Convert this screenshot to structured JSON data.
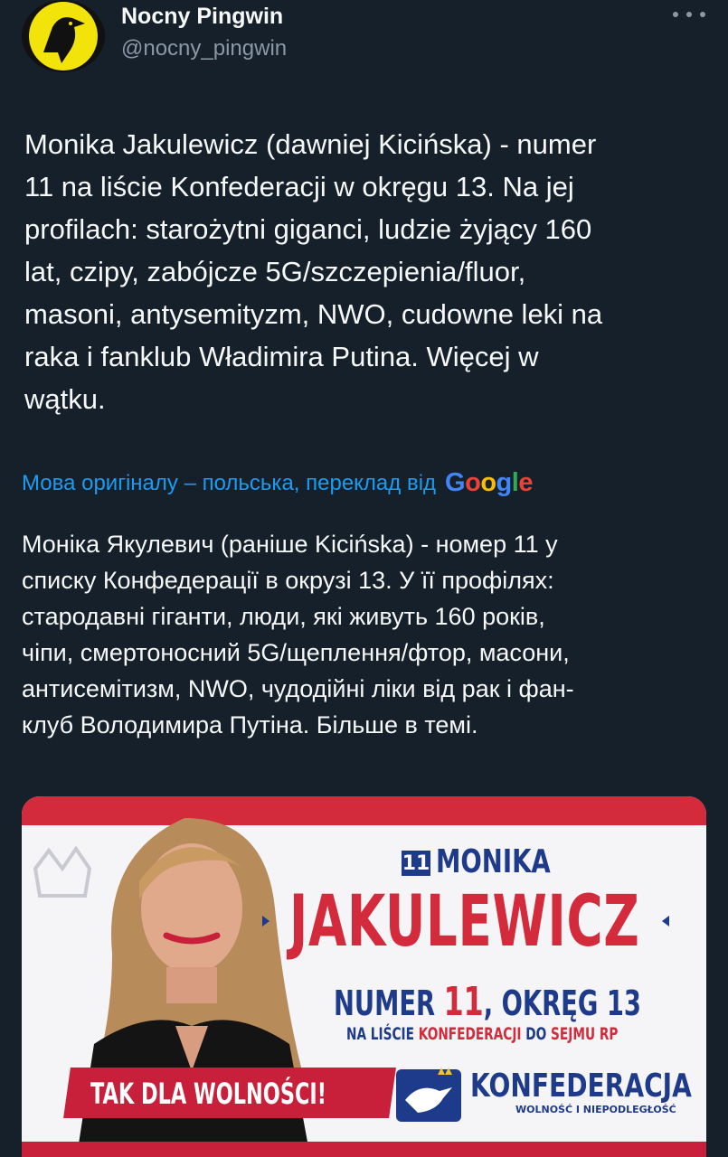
{
  "tweet": {
    "display_name": "Nocny Pingwin",
    "handle": "@nocny_pingwin",
    "text_lines": [
      "Monika Jakulewicz (dawniej Kicińska) - numer",
      "11 na liście Konfederacji w okręgu 13. Na jej",
      "profilach: starożytni giganci, ludzie żyjący 160",
      "lat, czipy, zabójcze 5G/szczepienia/fluor,",
      "masoni, antysemityzm, NWO, cudowne leki na",
      "raka i fanklub Władimira Putina. Więcej w",
      "wątku."
    ],
    "translation_notice": "Мова оригіналу – польська, переклад від",
    "translation_provider": "Google",
    "translated_lines": [
      "Моніка Якулевич (раніше Kicińska) - номер 11 у",
      "списку Конфедерації в окрузі 13. У її профілях:",
      "стародавні гіганти, люди, які живуть 160 років,",
      "чіпи, смертоносний 5G/щеплення/фтор, масони,",
      "антисемітизм, NWO, чудодійні ліки від рак і фан-",
      "клуб Володимира Путіна. Більше в темі."
    ]
  },
  "poster": {
    "number": "11",
    "first_name": "MONIKA",
    "last_name": "JAKULEWICZ",
    "numer_prefix": "NUMER",
    "numer_value": "11",
    "numer_suffix": ", OKRĘG 13",
    "list_prefix": "NA LIŚCIE",
    "list_party": "KONFEDERACJI",
    "list_mid": "DO",
    "list_target": "SEJMU RP",
    "slogan": "TAK DLA WOLNOŚCI!",
    "party_name": "KONFEDERACJA",
    "party_subtitle": "WOLNOŚĆ I NIEPODLEGŁOŚĆ"
  },
  "colors": {
    "background": "#15202b",
    "link": "#1d9bf0",
    "poster_red": "#d32a3c",
    "poster_blue": "#1e3a8a"
  },
  "icons": {
    "more": "more-horizontal-icon",
    "avatar": "crow-avatar",
    "party": "eagle-crown-logo"
  }
}
